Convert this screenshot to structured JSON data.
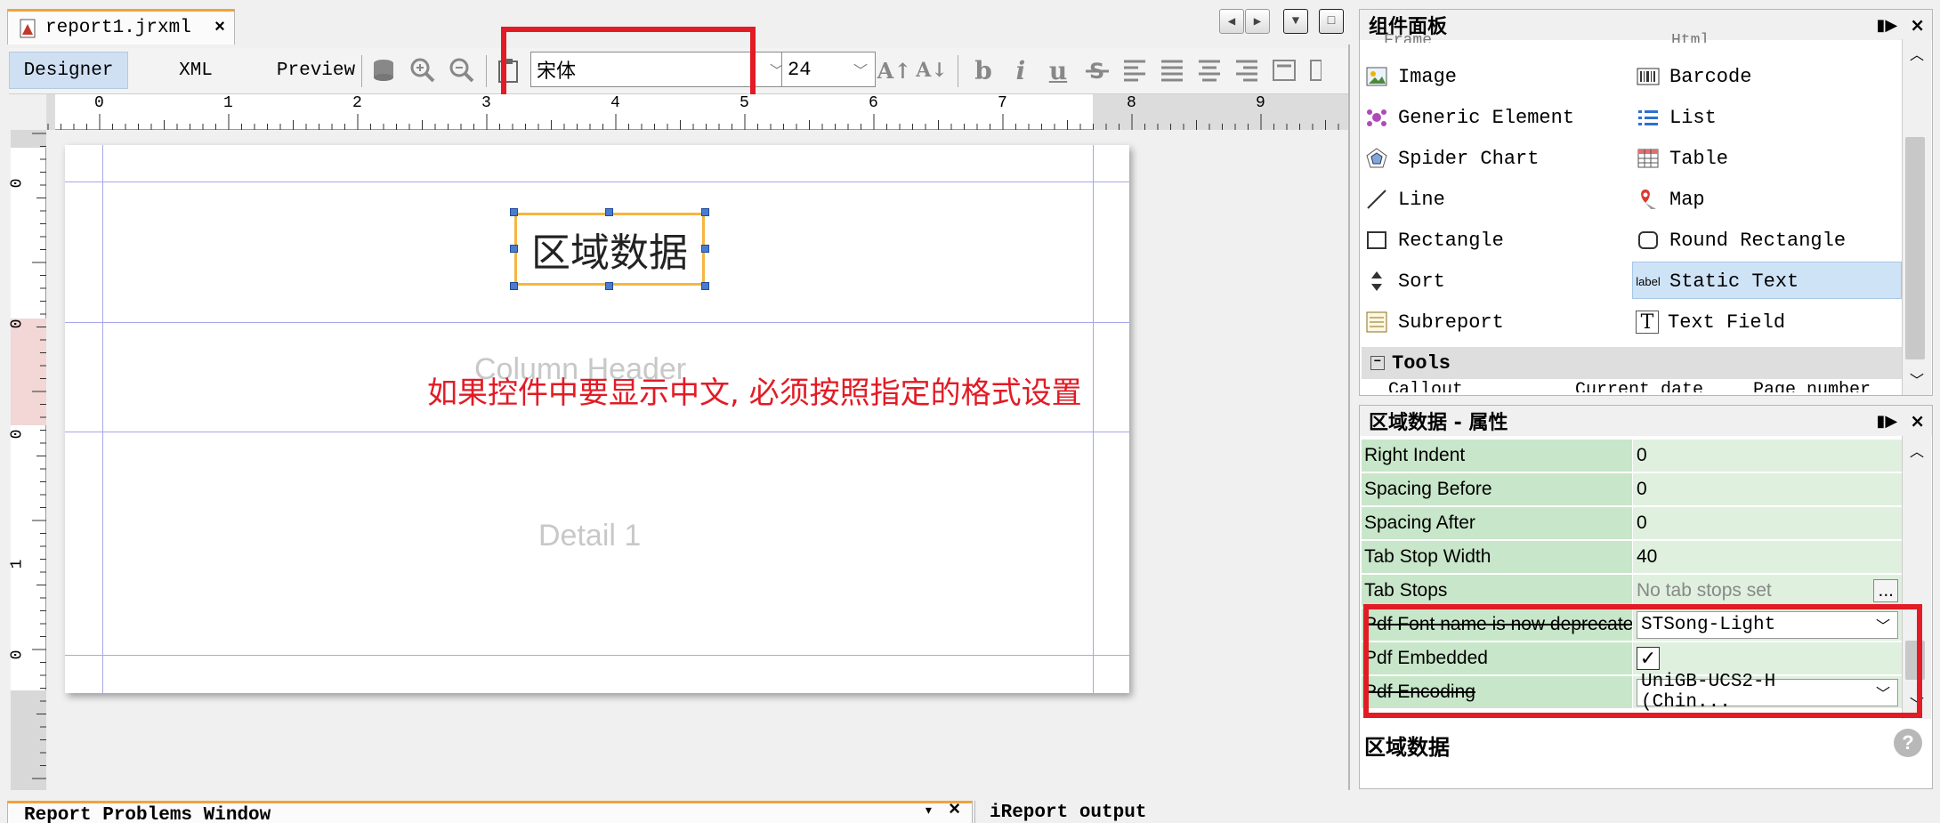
{
  "file_tab": {
    "name": "report1.jrxml",
    "close": "×"
  },
  "view_tabs": {
    "designer": "Designer",
    "xml": "XML",
    "preview": "Preview"
  },
  "toolbar": {
    "font_name": "宋体",
    "font_size": "24",
    "bold": "b",
    "italic": "i",
    "underline": "u"
  },
  "ruler": {
    "h_ticks": [
      "0",
      "1",
      "2",
      "3",
      "4",
      "5",
      "6",
      "7",
      "8",
      "9"
    ],
    "v_ticks": [
      "0",
      "0",
      "0",
      "1",
      "0"
    ]
  },
  "report": {
    "static_text": "区域数据",
    "column_header_label": "Column Header",
    "detail_label": "Detail 1",
    "note": "如果控件中要显示中文, 必须按照指定的格式设置"
  },
  "palette": {
    "title": "组件面板",
    "top_partial_left": "Frame",
    "top_partial_right": "Html",
    "items_left": [
      {
        "label": "Image",
        "icon": "image-icon"
      },
      {
        "label": "Generic Element",
        "icon": "generic-element-icon"
      },
      {
        "label": "Spider Chart",
        "icon": "spider-chart-icon"
      },
      {
        "label": "Line",
        "icon": "line-icon"
      },
      {
        "label": "Rectangle",
        "icon": "rectangle-icon"
      },
      {
        "label": "Sort",
        "icon": "sort-icon"
      },
      {
        "label": "Subreport",
        "icon": "subreport-icon"
      }
    ],
    "items_right": [
      {
        "label": "Barcode",
        "icon": "barcode-icon"
      },
      {
        "label": "List",
        "icon": "list-icon"
      },
      {
        "label": "Table",
        "icon": "table-icon"
      },
      {
        "label": "Map",
        "icon": "map-pin-icon"
      },
      {
        "label": "Round Rectangle",
        "icon": "round-rectangle-icon"
      },
      {
        "label": "Static Text",
        "icon": "static-text-icon",
        "icon_text": "label"
      },
      {
        "label": "Text Field",
        "icon": "text-field-icon",
        "icon_text": "T"
      }
    ],
    "tools_header": "Tools",
    "tools_partial": [
      "Callout",
      "Current date",
      "Page number"
    ]
  },
  "properties": {
    "title": "区域数据 - 属性",
    "rows": [
      {
        "key": "Right Indent",
        "value": "0"
      },
      {
        "key": "Spacing Before",
        "value": "0"
      },
      {
        "key": "Spacing After",
        "value": "0"
      },
      {
        "key": "Tab Stop Width",
        "value": "40"
      },
      {
        "key": "Tab Stops",
        "value": "No tab stops set"
      },
      {
        "key": "Pdf Font name is now deprecated",
        "value": "STSong-Light"
      },
      {
        "key": "Pdf Embedded",
        "value": "checked"
      },
      {
        "key": "Pdf Encoding",
        "value": "UniGB-UCS2-H (Chin..."
      }
    ],
    "footer_label": "区域数据"
  },
  "bottom": {
    "problems": "Report Problems Window",
    "output": "iReport output"
  },
  "colors": {
    "accent_orange": "#f2a23a",
    "highlight_red": "#e21b25",
    "prop_green": "#c8e6c9",
    "selected_blue": "#cfe0f3"
  }
}
